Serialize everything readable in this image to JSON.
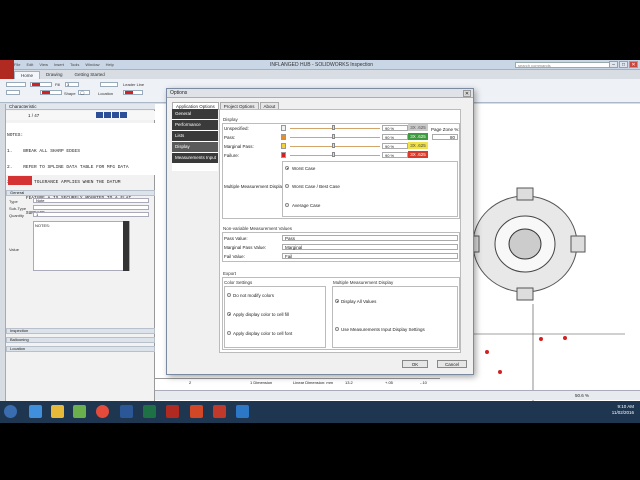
{
  "app": {
    "title": "INFLANGED HUB - SOLIDWORKS Inspection",
    "search_placeholder": "search commands",
    "quick_access": [
      "File",
      "Edit",
      "View",
      "Insert",
      "Tools",
      "Window",
      "Help"
    ]
  },
  "ribbon": {
    "tabs": [
      "Home",
      "Drawing",
      "Getting Started"
    ],
    "active_tab": "Home",
    "fill_label": "Fill",
    "fill_value": "3",
    "shape_label": "Shape",
    "location_label": "Location",
    "leader_line_label": "Leader Line",
    "accent_red": "#d42020"
  },
  "left_panel": {
    "header": "Characteristic",
    "nav_counter": "1 / 47",
    "notes_lines": [
      "NOTES:",
      "1.    BREAK ALL SHARP EDGES",
      "2.    REFER TO SPLINE DATA TABLE FOR MFG DATA",
      "3.    THE TOLERANCE APPLIES WHEN THE DATUM",
      "       FEATURE A IS SECURELY MOUNTED TO A FLAT",
      "       SURFACE."
    ],
    "general_label": "General",
    "type_label": "Type",
    "type_value": "Note",
    "subtype_label": "Sub-Type",
    "subtype_value": "",
    "quantity_label": "Quantity",
    "quantity_value": "1",
    "value_label": "Value",
    "value_text": "NOTES:",
    "sections": [
      "Inspection",
      "Ballooning",
      "Location"
    ]
  },
  "dialog": {
    "title": "Options",
    "close": "✕",
    "tabs": [
      "Application Options",
      "Project Options",
      "About"
    ],
    "active_tab": "Application Options",
    "categories": [
      "General",
      "Performance",
      "Lists",
      "Display",
      "Measurements Input"
    ],
    "active_category": "Display",
    "display_group_title": "Display",
    "rows": [
      {
        "label": "Unspecified:",
        "pct": "90 %",
        "chip": "3X .625",
        "chip_bg": "#c9c9c9",
        "chip_color": "#555",
        "swatch": "#f2f2f2"
      },
      {
        "label": "Pass:",
        "pct": "90 %",
        "chip": "3X .625",
        "chip_bg": "#3d9a3d",
        "chip_color": "#ffffff",
        "swatch": "#e38f2c"
      },
      {
        "label": "Marginal Pass:",
        "pct": "90 %",
        "chip": "3X .625",
        "chip_bg": "#f0e14a",
        "chip_color": "#444",
        "swatch": "#f0d23a"
      },
      {
        "label": "Failure:",
        "pct": "90 %",
        "chip": "3X .625",
        "chip_bg": "#d93a2a",
        "chip_color": "#ffffff",
        "swatch": "#d42020"
      }
    ],
    "page_zone_label": "Page Zone %:",
    "page_zone_value": "80",
    "multiple_display_label": "Multiple Measurement Display",
    "multiple_display_options": [
      "Worst Case",
      "Worst Case / Best Case",
      "Average Case"
    ],
    "multiple_display_selected": 0,
    "nonvariable_title": "Non-variable Measurement Values",
    "pass_value_label": "Pass Value:",
    "pass_value": "Pass",
    "marginal_value_label": "Marginal Pass Value:",
    "marginal_value": "Marginal",
    "fail_value_label": "Fail Value:",
    "fail_value": "Fail",
    "export_title": "Export",
    "color_settings_title": "Color Settings",
    "color_options": [
      "Do not modify colors",
      "Apply display color to cell fill",
      "Apply display color to cell font"
    ],
    "color_selected": 1,
    "multi_export_title": "Multiple Measurement Display",
    "multi_export_options": [
      "Display All Values",
      "Use Measurements Input Display Settings"
    ],
    "multi_export_selected": 0,
    "ok_label": "OK",
    "cancel_label": "Cancel"
  },
  "table_row": {
    "num": "2",
    "dim": "1 Dimension",
    "type": "Linear Dimension: mm",
    "nom": "13.2",
    "tol": "+.05",
    "lim": "-.10"
  },
  "statusbar": {
    "zoom": "50.6 %"
  },
  "taskbar": {
    "time": "9:10 AM",
    "date": "11/02/2016"
  }
}
